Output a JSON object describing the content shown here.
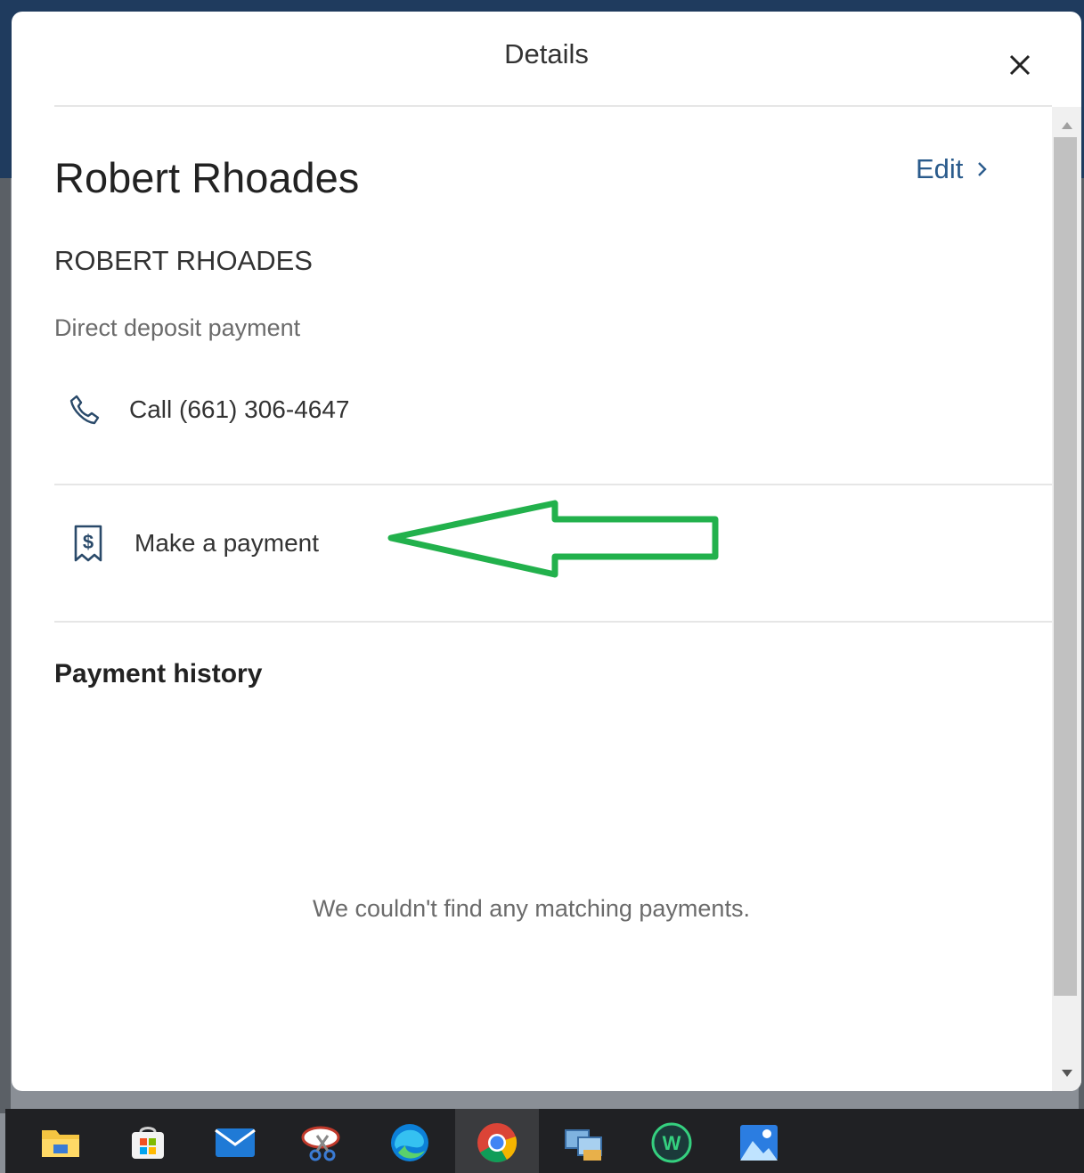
{
  "modal": {
    "title": "Details",
    "close_icon": "close-icon"
  },
  "payee": {
    "name": "Robert Rhoades",
    "edit_label": "Edit",
    "account_name": "ROBERT RHOADES",
    "payment_method": "Direct deposit payment"
  },
  "actions": {
    "call_label": "Call (661) 306-4647",
    "call_icon": "phone-icon",
    "pay_label": "Make a payment",
    "pay_icon": "receipt-dollar-icon"
  },
  "history": {
    "title": "Payment history",
    "empty_message": "We couldn't find any matching payments."
  },
  "annotation": {
    "color": "#22b14c",
    "icon": "arrow-left-annotation"
  },
  "taskbar": {
    "items": [
      "file-explorer-icon",
      "microsoft-store-icon",
      "mail-icon",
      "snipping-tool-icon",
      "edge-icon",
      "chrome-icon",
      "network-app-icon",
      "w-app-icon",
      "photos-icon"
    ],
    "active": "chrome-icon"
  },
  "colors": {
    "link": "#2a5b8c",
    "text": "#333333",
    "muted": "#6b6b6b"
  }
}
